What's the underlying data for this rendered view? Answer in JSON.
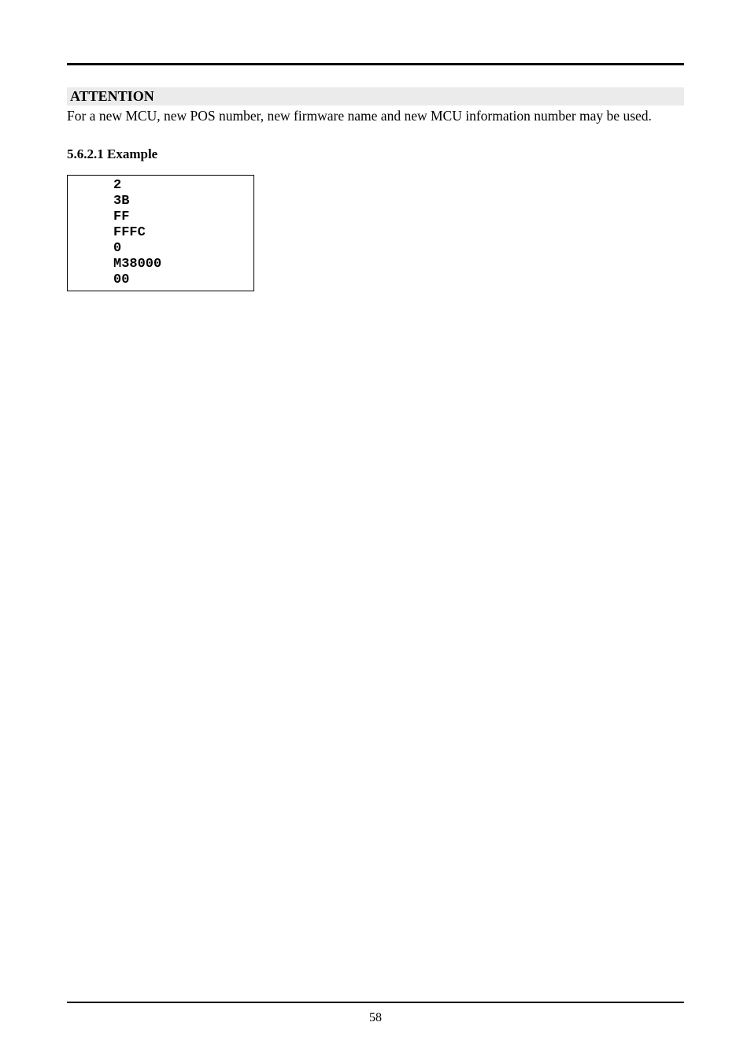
{
  "attention": {
    "heading": "ATTENTION",
    "body": "For a new MCU, new POS number, new firmware name and new MCU information number may be used."
  },
  "section": {
    "number": "5.6.2.1",
    "title": "Example"
  },
  "code": {
    "lines": [
      "2",
      "3B",
      "FF",
      "FFFC",
      "0",
      "M38000",
      "00"
    ]
  },
  "page_number": "58"
}
